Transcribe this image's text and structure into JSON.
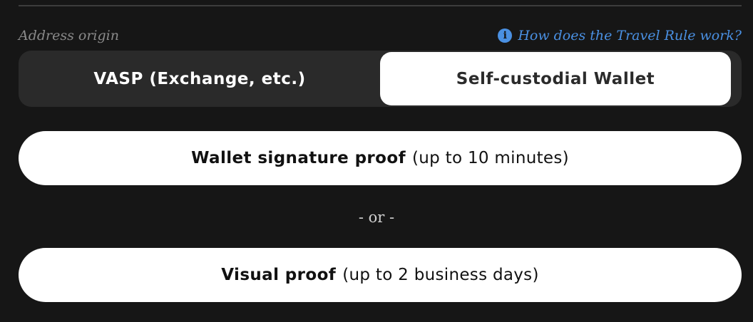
{
  "address_origin": {
    "label": "Address origin",
    "help_link": {
      "icon": "info-icon",
      "icon_glyph": "i",
      "text": "How does the Travel Rule work?"
    },
    "options": [
      {
        "label": "VASP (Exchange, etc.)",
        "selected": false
      },
      {
        "label": "Self-custodial Wallet",
        "selected": true
      }
    ]
  },
  "proofs": {
    "signature": {
      "title": "Wallet signature proof",
      "duration": "(up to 10 minutes)"
    },
    "separator": "- or -",
    "visual": {
      "title": "Visual proof",
      "duration": "(up to 2 business days)"
    }
  },
  "colors": {
    "background": "#161616",
    "accent": "#4a90e2",
    "segment_bg": "#2a2a2a",
    "button_bg": "#ffffff"
  }
}
